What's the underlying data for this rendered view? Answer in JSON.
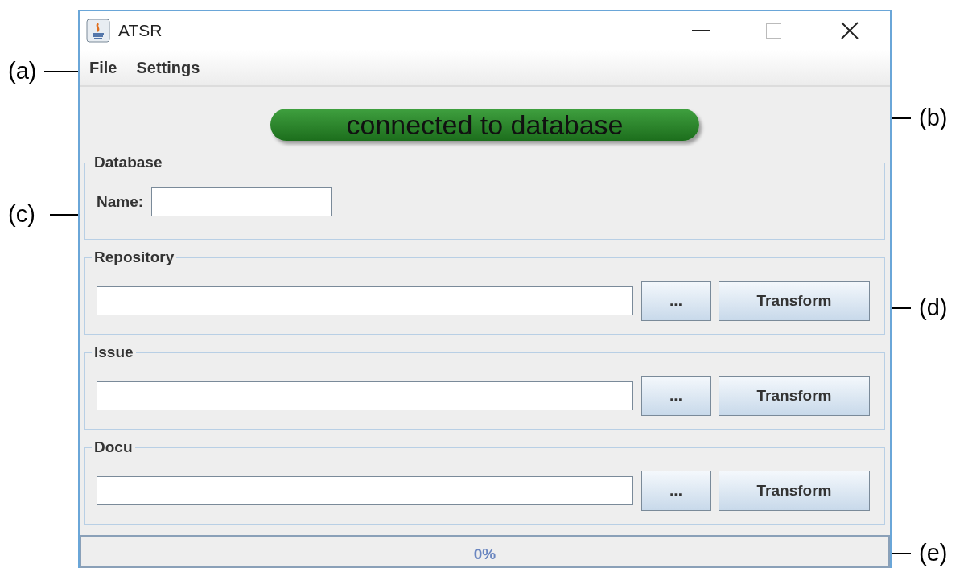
{
  "window": {
    "title": "ATSR"
  },
  "menu": [
    "File",
    "Settings"
  ],
  "status": {
    "text": "connected to database",
    "connected": true
  },
  "database": {
    "title": "Database",
    "name_label": "Name:"
  },
  "sections": [
    {
      "title": "Repository",
      "browse_label": "...",
      "transform_label": "Transform"
    },
    {
      "title": "Issue",
      "browse_label": "...",
      "transform_label": "Transform"
    },
    {
      "title": "Docu",
      "browse_label": "...",
      "transform_label": "Transform"
    }
  ],
  "progress": {
    "level": 0,
    "text": "0%"
  },
  "callouts": [
    {
      "label": "(a)",
      "kind": "menu"
    },
    {
      "label": "(b)",
      "kind": "status"
    },
    {
      "label": "(c)",
      "kind": "name"
    },
    {
      "label": "(d)",
      "kind": "transform"
    },
    {
      "label": "(e)",
      "kind": "progress"
    }
  ]
}
